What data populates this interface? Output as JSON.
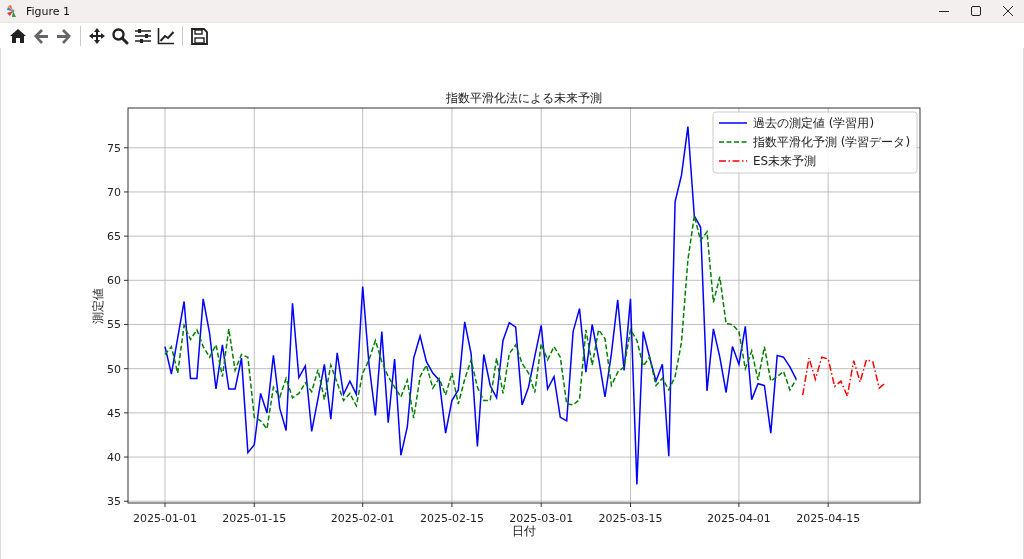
{
  "window": {
    "title": "Figure 1"
  },
  "toolbar": {
    "buttons": [
      {
        "kind": "home"
      },
      {
        "kind": "back"
      },
      {
        "kind": "forward"
      },
      {
        "kind": "separator"
      },
      {
        "kind": "pan"
      },
      {
        "kind": "zoom"
      },
      {
        "kind": "configure"
      },
      {
        "kind": "edit"
      },
      {
        "kind": "separator"
      },
      {
        "kind": "save"
      }
    ]
  },
  "figure": {
    "chart_data": {
      "type": "line",
      "title": "指数平滑化法による未来予測",
      "xlabel": "日付",
      "ylabel": "測定値",
      "categories": [
        "2025-01-01",
        null,
        null,
        null,
        null,
        null,
        null,
        null,
        null,
        null,
        null,
        null,
        null,
        null,
        "2025-01-15",
        null,
        null,
        null,
        null,
        null,
        null,
        null,
        null,
        null,
        null,
        null,
        null,
        null,
        null,
        null,
        null,
        "2025-02-01",
        null,
        null,
        null,
        null,
        null,
        null,
        null,
        null,
        null,
        null,
        null,
        null,
        null,
        "2025-02-15",
        null,
        null,
        null,
        null,
        null,
        null,
        null,
        null,
        null,
        null,
        null,
        null,
        null,
        "2025-03-01",
        null,
        null,
        null,
        null,
        null,
        null,
        null,
        null,
        null,
        null,
        null,
        null,
        null,
        "2025-03-15",
        null,
        null,
        null,
        null,
        null,
        null,
        null,
        null,
        null,
        null,
        null,
        null,
        null,
        null,
        null,
        null,
        "2025-04-01",
        null,
        null,
        null,
        null,
        null,
        null,
        null,
        null,
        null,
        null,
        null,
        null,
        null,
        "2025-04-15",
        null,
        null,
        null,
        null,
        null,
        null,
        null,
        null,
        null
      ],
      "series": [
        {
          "name": "過去の測定値 (学習用)",
          "color": "#0000ff",
          "line_style": "solid",
          "values": [
            52.5,
            49.4,
            53.5,
            57.6,
            48.9,
            48.9,
            57.9,
            54.0,
            47.7,
            52.7,
            47.7,
            47.7,
            51.2,
            40.5,
            41.4,
            47.2,
            45.0,
            51.5,
            45.5,
            43.0,
            57.4,
            49.0,
            50.3,
            42.9,
            46.6,
            50.5,
            44.3,
            51.8,
            47.1,
            48.6,
            47.1,
            59.3,
            50.5,
            44.7,
            54.2,
            43.9,
            51.1,
            40.2,
            43.4,
            51.2,
            53.7,
            50.8,
            49.5,
            48.7,
            42.7,
            46.4,
            47.6,
            55.3,
            51.7,
            41.2,
            51.6,
            48.1,
            46.7,
            53.2,
            55.2,
            54.7,
            45.9,
            47.9,
            51.4,
            54.9,
            47.7,
            49.1,
            44.5,
            44.1,
            54.2,
            56.8,
            49.6,
            55.0,
            51.2,
            46.8,
            51.7,
            57.8,
            49.8,
            57.9,
            36.9,
            54.2,
            51.3,
            48.6,
            50.5,
            40.1,
            68.9,
            71.9,
            77.4,
            67.3,
            66.0,
            47.5,
            54.5,
            51.3,
            47.3,
            52.5,
            50.5,
            54.8,
            46.5,
            48.3,
            48.1,
            42.7,
            51.5,
            51.3,
            50.2,
            48.8,
            null,
            null,
            null,
            null,
            null,
            null,
            null,
            null,
            null,
            null,
            null,
            null,
            null,
            null
          ]
        },
        {
          "name": "指数平滑化予測 (学習データ)",
          "color": "#008000",
          "line_style": "dashed",
          "values": [
            51.6,
            52.5,
            49.5,
            54.9,
            53.3,
            54.4,
            52.5,
            51.3,
            52.7,
            49.1,
            54.5,
            49.8,
            51.6,
            51.3,
            44.5,
            44.1,
            43.2,
            47.9,
            46.8,
            48.9,
            46.7,
            47.2,
            48.4,
            47.4,
            49.9,
            46.5,
            50.4,
            48.4,
            46.4,
            47.2,
            45.8,
            49.5,
            51.0,
            53.2,
            50.8,
            49.1,
            47.9,
            46.8,
            48.7,
            44.4,
            49.1,
            50.4,
            47.8,
            48.9,
            47.0,
            49.5,
            46.0,
            48.8,
            51.0,
            47.9,
            46.4,
            46.4,
            51.2,
            47.2,
            51.7,
            52.7,
            50.6,
            49.5,
            47.3,
            52.8,
            51.0,
            52.5,
            51.3,
            46.0,
            45.9,
            46.5,
            54.4,
            50.4,
            54.4,
            53.4,
            48.1,
            49.6,
            50.2,
            54.4,
            53.2,
            50.3,
            51.3,
            48.1,
            48.9,
            47.6,
            49.1,
            53.0,
            62.3,
            67.3,
            64.5,
            65.5,
            57.5,
            60.4,
            55.1,
            55.0,
            54.2,
            50.0,
            52.0,
            48.7,
            52.5,
            48.6,
            49.1,
            49.7,
            47.6,
            48.8,
            null,
            null,
            null,
            null,
            null,
            null,
            null,
            null,
            null,
            null,
            null,
            null,
            null,
            null
          ]
        },
        {
          "name": "ES未来予測",
          "color": "#ff0000",
          "line_style": "dashdot",
          "values": [
            null,
            null,
            null,
            null,
            null,
            null,
            null,
            null,
            null,
            null,
            null,
            null,
            null,
            null,
            null,
            null,
            null,
            null,
            null,
            null,
            null,
            null,
            null,
            null,
            null,
            null,
            null,
            null,
            null,
            null,
            null,
            null,
            null,
            null,
            null,
            null,
            null,
            null,
            null,
            null,
            null,
            null,
            null,
            null,
            null,
            null,
            null,
            null,
            null,
            null,
            null,
            null,
            null,
            null,
            null,
            null,
            null,
            null,
            null,
            null,
            null,
            null,
            null,
            null,
            null,
            null,
            null,
            null,
            null,
            null,
            null,
            null,
            null,
            null,
            null,
            null,
            null,
            null,
            null,
            null,
            null,
            null,
            null,
            null,
            null,
            null,
            null,
            null,
            null,
            null,
            null,
            null,
            null,
            null,
            null,
            null,
            null,
            null,
            null,
            null,
            47.0,
            51.2,
            48.8,
            51.3,
            51.1,
            48.0,
            48.6,
            46.9,
            50.9,
            48.5,
            51.0,
            50.8,
            47.8,
            48.4
          ]
        }
      ],
      "ylim": [
        34.8,
        79.5
      ],
      "grid": true,
      "legend": true,
      "yticks": [
        35,
        40,
        45,
        50,
        55,
        60,
        65,
        70,
        75
      ]
    }
  }
}
